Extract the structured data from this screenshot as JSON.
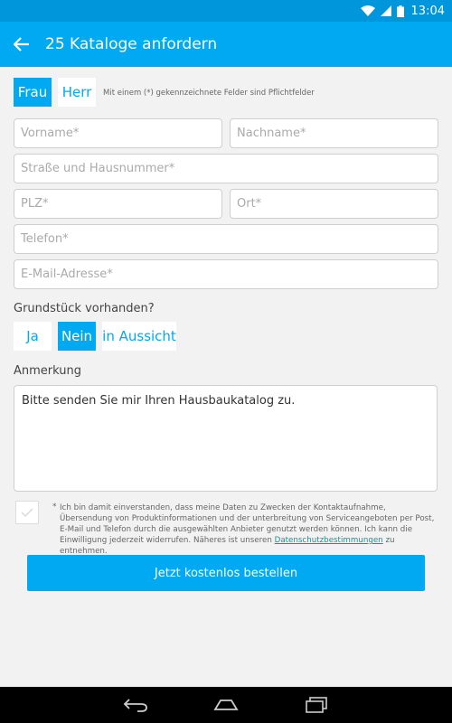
{
  "status": {
    "time": "13:04"
  },
  "appbar": {
    "title": "25 Kataloge anfordern"
  },
  "salutation": {
    "options": [
      "Frau",
      "Herr"
    ],
    "selected": "Frau"
  },
  "required_note": "Mit einem (*) gekennzeichnete Felder sind Pflichtfelder",
  "fields": {
    "vorname": "Vorname*",
    "nachname": "Nachname*",
    "strasse": "Straße und Hausnummer*",
    "plz": "PLZ*",
    "ort": "Ort*",
    "telefon": "Telefon*",
    "email": "E-Mail-Adresse*"
  },
  "grundstueck": {
    "label": "Grundstück vorhanden?",
    "options": [
      "Ja",
      "Nein",
      "in Aussicht"
    ],
    "selected": "Nein"
  },
  "anmerkung": {
    "label": "Anmerkung",
    "value": "Bitte senden Sie mir Ihren Hausbaukatalog zu."
  },
  "consent": {
    "star": "*",
    "text": "Ich bin damit einverstanden, dass meine Daten zu Zwecken der Kontaktaufnahme, Übersendung von Produktinformationen und der unterbreitung von Serviceangeboten per Post, E-Mail und Telefon durch die ausgewählten Anbieter genutzt werden können. Ich kann die Einwilligung jederzeit widerrufen. Näheres ist unseren ",
    "link": "Datenschutzbestimmungen",
    "suffix": " zu entnehmen."
  },
  "submit_label": "Jetzt kostenlos bestellen",
  "colors": {
    "accent": "#00a9f1",
    "statusbar": "#0096db",
    "link": "#0a9a8f"
  }
}
